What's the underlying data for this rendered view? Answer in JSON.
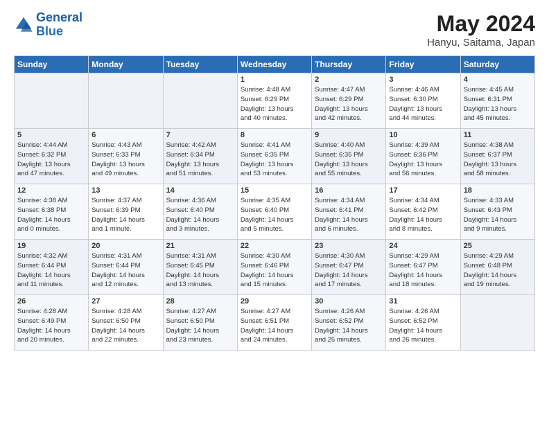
{
  "header": {
    "logo_line1": "General",
    "logo_line2": "Blue",
    "month_title": "May 2024",
    "location": "Hanyu, Saitama, Japan"
  },
  "weekdays": [
    "Sunday",
    "Monday",
    "Tuesday",
    "Wednesday",
    "Thursday",
    "Friday",
    "Saturday"
  ],
  "weeks": [
    [
      {
        "day": "",
        "info": ""
      },
      {
        "day": "",
        "info": ""
      },
      {
        "day": "",
        "info": ""
      },
      {
        "day": "1",
        "info": "Sunrise: 4:48 AM\nSunset: 6:29 PM\nDaylight: 13 hours\nand 40 minutes."
      },
      {
        "day": "2",
        "info": "Sunrise: 4:47 AM\nSunset: 6:29 PM\nDaylight: 13 hours\nand 42 minutes."
      },
      {
        "day": "3",
        "info": "Sunrise: 4:46 AM\nSunset: 6:30 PM\nDaylight: 13 hours\nand 44 minutes."
      },
      {
        "day": "4",
        "info": "Sunrise: 4:45 AM\nSunset: 6:31 PM\nDaylight: 13 hours\nand 45 minutes."
      }
    ],
    [
      {
        "day": "5",
        "info": "Sunrise: 4:44 AM\nSunset: 6:32 PM\nDaylight: 13 hours\nand 47 minutes."
      },
      {
        "day": "6",
        "info": "Sunrise: 4:43 AM\nSunset: 6:33 PM\nDaylight: 13 hours\nand 49 minutes."
      },
      {
        "day": "7",
        "info": "Sunrise: 4:42 AM\nSunset: 6:34 PM\nDaylight: 13 hours\nand 51 minutes."
      },
      {
        "day": "8",
        "info": "Sunrise: 4:41 AM\nSunset: 6:35 PM\nDaylight: 13 hours\nand 53 minutes."
      },
      {
        "day": "9",
        "info": "Sunrise: 4:40 AM\nSunset: 6:35 PM\nDaylight: 13 hours\nand 55 minutes."
      },
      {
        "day": "10",
        "info": "Sunrise: 4:39 AM\nSunset: 6:36 PM\nDaylight: 13 hours\nand 56 minutes."
      },
      {
        "day": "11",
        "info": "Sunrise: 4:38 AM\nSunset: 6:37 PM\nDaylight: 13 hours\nand 58 minutes."
      }
    ],
    [
      {
        "day": "12",
        "info": "Sunrise: 4:38 AM\nSunset: 6:38 PM\nDaylight: 14 hours\nand 0 minutes."
      },
      {
        "day": "13",
        "info": "Sunrise: 4:37 AM\nSunset: 6:39 PM\nDaylight: 14 hours\nand 1 minute."
      },
      {
        "day": "14",
        "info": "Sunrise: 4:36 AM\nSunset: 6:40 PM\nDaylight: 14 hours\nand 3 minutes."
      },
      {
        "day": "15",
        "info": "Sunrise: 4:35 AM\nSunset: 6:40 PM\nDaylight: 14 hours\nand 5 minutes."
      },
      {
        "day": "16",
        "info": "Sunrise: 4:34 AM\nSunset: 6:41 PM\nDaylight: 14 hours\nand 6 minutes."
      },
      {
        "day": "17",
        "info": "Sunrise: 4:34 AM\nSunset: 6:42 PM\nDaylight: 14 hours\nand 8 minutes."
      },
      {
        "day": "18",
        "info": "Sunrise: 4:33 AM\nSunset: 6:43 PM\nDaylight: 14 hours\nand 9 minutes."
      }
    ],
    [
      {
        "day": "19",
        "info": "Sunrise: 4:32 AM\nSunset: 6:44 PM\nDaylight: 14 hours\nand 11 minutes."
      },
      {
        "day": "20",
        "info": "Sunrise: 4:31 AM\nSunset: 6:44 PM\nDaylight: 14 hours\nand 12 minutes."
      },
      {
        "day": "21",
        "info": "Sunrise: 4:31 AM\nSunset: 6:45 PM\nDaylight: 14 hours\nand 13 minutes."
      },
      {
        "day": "22",
        "info": "Sunrise: 4:30 AM\nSunset: 6:46 PM\nDaylight: 14 hours\nand 15 minutes."
      },
      {
        "day": "23",
        "info": "Sunrise: 4:30 AM\nSunset: 6:47 PM\nDaylight: 14 hours\nand 17 minutes."
      },
      {
        "day": "24",
        "info": "Sunrise: 4:29 AM\nSunset: 6:47 PM\nDaylight: 14 hours\nand 18 minutes."
      },
      {
        "day": "25",
        "info": "Sunrise: 4:29 AM\nSunset: 6:48 PM\nDaylight: 14 hours\nand 19 minutes."
      }
    ],
    [
      {
        "day": "26",
        "info": "Sunrise: 4:28 AM\nSunset: 6:49 PM\nDaylight: 14 hours\nand 20 minutes."
      },
      {
        "day": "27",
        "info": "Sunrise: 4:28 AM\nSunset: 6:50 PM\nDaylight: 14 hours\nand 22 minutes."
      },
      {
        "day": "28",
        "info": "Sunrise: 4:27 AM\nSunset: 6:50 PM\nDaylight: 14 hours\nand 23 minutes."
      },
      {
        "day": "29",
        "info": "Sunrise: 4:27 AM\nSunset: 6:51 PM\nDaylight: 14 hours\nand 24 minutes."
      },
      {
        "day": "30",
        "info": "Sunrise: 4:26 AM\nSunset: 6:52 PM\nDaylight: 14 hours\nand 25 minutes."
      },
      {
        "day": "31",
        "info": "Sunrise: 4:26 AM\nSunset: 6:52 PM\nDaylight: 14 hours\nand 26 minutes."
      },
      {
        "day": "",
        "info": ""
      }
    ]
  ]
}
